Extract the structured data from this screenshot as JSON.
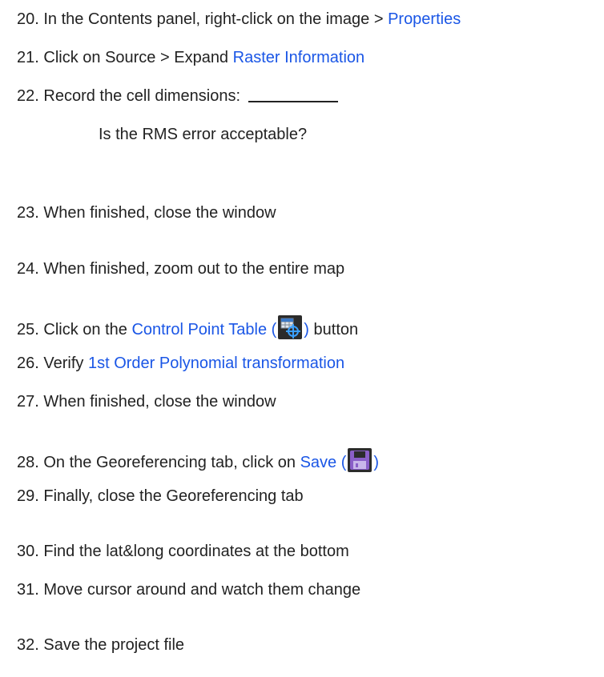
{
  "steps": [
    {
      "num": "20.",
      "pre": "In the Contents panel, right-click on the image > ",
      "link": "Properties"
    },
    {
      "num": "21.",
      "pre": "Click on Source > Expand ",
      "link": "Raster Information"
    },
    {
      "num": "22.",
      "pre": "Record the cell dimensions:"
    },
    {
      "question": "Is the RMS error acceptable?"
    },
    {
      "num": "23.",
      "pre": "When finished, close the window"
    },
    {
      "num": "24.",
      "pre": "When finished, zoom out to the entire map"
    },
    {
      "num": "25.",
      "pre": "Click on the ",
      "link": "Control Point Table (",
      "link_close": ")",
      "post": " button",
      "icon": "control-point-table-icon"
    },
    {
      "num": "26.",
      "pre": "Verify ",
      "link": "1st Order Polynomial transformation"
    },
    {
      "num": "27.",
      "pre": "When finished, close the window"
    },
    {
      "num": "28.",
      "pre": "On the Georeferencing tab, click on ",
      "link": "Save (",
      "link_close": ")",
      "icon": "save-icon"
    },
    {
      "num": "29.",
      "pre": "Finally, close the Georeferencing tab"
    },
    {
      "num": "30.",
      "pre": "Find the lat&long coordinates at the bottom"
    },
    {
      "num": "31.",
      "pre": "Move cursor around and watch them change"
    },
    {
      "num": "32.",
      "pre": "Save the project file"
    }
  ],
  "colors": {
    "link": "#1a56e6",
    "text": "#222222"
  }
}
